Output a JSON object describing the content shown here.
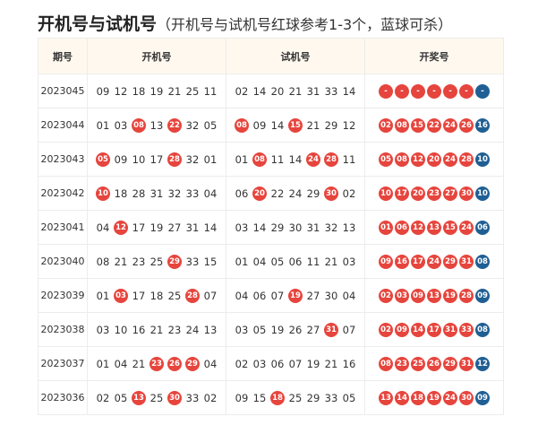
{
  "colors": {
    "red": "#e6453d",
    "blue": "#1f5f94",
    "header_bg": "#fff8ef"
  },
  "title": {
    "main": "开机号与试机号",
    "sub": "（开机号与试机号红球参考1-3个，蓝球可杀）"
  },
  "table": {
    "headers": [
      "期号",
      "开机号",
      "试机号",
      "开奖号"
    ],
    "rows": [
      {
        "period": "2023045",
        "kaiji": [
          "09",
          "12",
          "18",
          "19",
          "21",
          "25",
          "11"
        ],
        "kaiji_hits": [],
        "shiji": [
          "02",
          "14",
          "20",
          "21",
          "31",
          "33",
          "14"
        ],
        "shiji_hits": [],
        "prize_red": [
          "-",
          "-",
          "-",
          "-",
          "-",
          "-"
        ],
        "prize_blue": "-"
      },
      {
        "period": "2023044",
        "kaiji": [
          "01",
          "03",
          "08",
          "13",
          "22",
          "32",
          "05"
        ],
        "kaiji_hits": [
          2,
          4
        ],
        "shiji": [
          "08",
          "09",
          "14",
          "15",
          "21",
          "29",
          "12"
        ],
        "shiji_hits": [
          0,
          3
        ],
        "prize_red": [
          "02",
          "08",
          "15",
          "22",
          "24",
          "26"
        ],
        "prize_blue": "16"
      },
      {
        "period": "2023043",
        "kaiji": [
          "05",
          "09",
          "10",
          "17",
          "28",
          "32",
          "01"
        ],
        "kaiji_hits": [
          0,
          4
        ],
        "shiji": [
          "01",
          "08",
          "11",
          "14",
          "24",
          "28",
          "11"
        ],
        "shiji_hits": [
          1,
          4,
          5
        ],
        "prize_red": [
          "05",
          "08",
          "12",
          "20",
          "24",
          "28"
        ],
        "prize_blue": "10"
      },
      {
        "period": "2023042",
        "kaiji": [
          "10",
          "18",
          "28",
          "31",
          "32",
          "33",
          "04"
        ],
        "kaiji_hits": [
          0
        ],
        "shiji": [
          "06",
          "20",
          "22",
          "24",
          "29",
          "30",
          "02"
        ],
        "shiji_hits": [
          1,
          5
        ],
        "prize_red": [
          "10",
          "17",
          "20",
          "23",
          "27",
          "30"
        ],
        "prize_blue": "10"
      },
      {
        "period": "2023041",
        "kaiji": [
          "04",
          "12",
          "17",
          "19",
          "27",
          "31",
          "14"
        ],
        "kaiji_hits": [
          1
        ],
        "shiji": [
          "03",
          "14",
          "29",
          "30",
          "31",
          "32",
          "13"
        ],
        "shiji_hits": [],
        "prize_red": [
          "01",
          "06",
          "12",
          "13",
          "15",
          "24"
        ],
        "prize_blue": "06"
      },
      {
        "period": "2023040",
        "kaiji": [
          "08",
          "21",
          "23",
          "25",
          "29",
          "33",
          "15"
        ],
        "kaiji_hits": [
          4
        ],
        "shiji": [
          "01",
          "04",
          "05",
          "06",
          "11",
          "21",
          "03"
        ],
        "shiji_hits": [],
        "prize_red": [
          "09",
          "16",
          "17",
          "24",
          "29",
          "31"
        ],
        "prize_blue": "08"
      },
      {
        "period": "2023039",
        "kaiji": [
          "01",
          "03",
          "17",
          "18",
          "25",
          "28",
          "07"
        ],
        "kaiji_hits": [
          1,
          5
        ],
        "shiji": [
          "04",
          "06",
          "07",
          "19",
          "27",
          "30",
          "04"
        ],
        "shiji_hits": [
          3
        ],
        "prize_red": [
          "02",
          "03",
          "09",
          "13",
          "19",
          "28"
        ],
        "prize_blue": "09"
      },
      {
        "period": "2023038",
        "kaiji": [
          "03",
          "10",
          "16",
          "21",
          "23",
          "24",
          "13"
        ],
        "kaiji_hits": [],
        "shiji": [
          "03",
          "05",
          "19",
          "26",
          "27",
          "31",
          "07"
        ],
        "shiji_hits": [
          5
        ],
        "prize_red": [
          "02",
          "09",
          "14",
          "17",
          "31",
          "33"
        ],
        "prize_blue": "08"
      },
      {
        "period": "2023037",
        "kaiji": [
          "01",
          "04",
          "21",
          "23",
          "26",
          "29",
          "04"
        ],
        "kaiji_hits": [
          3,
          4,
          5
        ],
        "shiji": [
          "02",
          "03",
          "06",
          "07",
          "19",
          "21",
          "16"
        ],
        "shiji_hits": [],
        "prize_red": [
          "08",
          "23",
          "25",
          "26",
          "29",
          "31"
        ],
        "prize_blue": "12"
      },
      {
        "period": "2023036",
        "kaiji": [
          "02",
          "05",
          "13",
          "25",
          "30",
          "33",
          "02"
        ],
        "kaiji_hits": [
          2,
          4
        ],
        "shiji": [
          "09",
          "15",
          "18",
          "25",
          "29",
          "33",
          "05"
        ],
        "shiji_hits": [
          2
        ],
        "prize_red": [
          "13",
          "14",
          "18",
          "19",
          "24",
          "30"
        ],
        "prize_blue": "09"
      }
    ]
  }
}
